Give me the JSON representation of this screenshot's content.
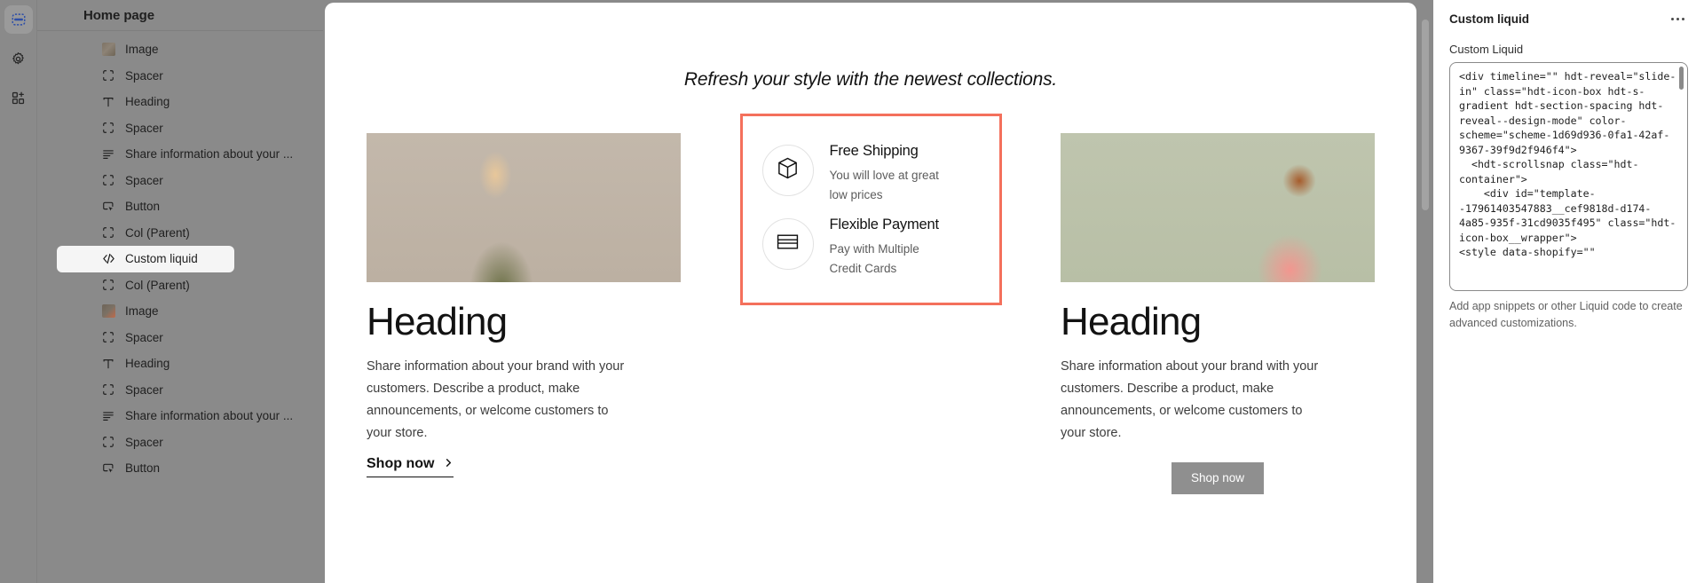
{
  "rail": {
    "items": [
      {
        "name": "sections-icon",
        "label": "Sections",
        "active": true
      },
      {
        "name": "settings-gear-icon",
        "label": "Theme settings",
        "active": false
      },
      {
        "name": "add-apps-icon",
        "label": "Apps",
        "active": false
      }
    ]
  },
  "sidebar": {
    "title": "Home page",
    "items": [
      {
        "label": "Image",
        "icon": "image-thumbnail-icon",
        "selected": false
      },
      {
        "label": "Spacer",
        "icon": "spacer-icon",
        "selected": false
      },
      {
        "label": "Heading",
        "icon": "text-heading-icon",
        "selected": false
      },
      {
        "label": "Spacer",
        "icon": "spacer-icon",
        "selected": false
      },
      {
        "label": "Share information about your ...",
        "icon": "rich-text-icon",
        "selected": false
      },
      {
        "label": "Spacer",
        "icon": "spacer-icon",
        "selected": false
      },
      {
        "label": "Button",
        "icon": "button-cursor-icon",
        "selected": false
      },
      {
        "label": "Col (Parent)",
        "icon": "spacer-icon",
        "selected": false
      },
      {
        "label": "Custom liquid",
        "icon": "code-icon",
        "selected": true
      },
      {
        "label": "Col (Parent)",
        "icon": "spacer-icon",
        "selected": false
      },
      {
        "label": "Image",
        "icon": "image-thumbnail-icon-b",
        "selected": false
      },
      {
        "label": "Spacer",
        "icon": "spacer-icon",
        "selected": false
      },
      {
        "label": "Heading",
        "icon": "text-heading-icon",
        "selected": false
      },
      {
        "label": "Spacer",
        "icon": "spacer-icon",
        "selected": false
      },
      {
        "label": "Share information about your ...",
        "icon": "rich-text-icon",
        "selected": false
      },
      {
        "label": "Spacer",
        "icon": "spacer-icon",
        "selected": false
      },
      {
        "label": "Button",
        "icon": "button-cursor-icon",
        "selected": false
      }
    ]
  },
  "preview": {
    "tagline": "Refresh your style with the newest collections.",
    "left_column": {
      "heading": "Heading",
      "body": "Share information about your brand with your customers. Describe a product, make announcements, or welcome customers to your store.",
      "link_label": "Shop now"
    },
    "right_column": {
      "heading": "Heading",
      "body": "Share information about your brand with your customers. Describe a product, make announcements, or welcome customers to your store.",
      "button_label": "Shop now"
    },
    "icon_box": {
      "highlight_color": "#f4705c",
      "rows": [
        {
          "icon": "box-package-icon",
          "title": "Free Shipping",
          "subtitle": "You will love at great low prices"
        },
        {
          "icon": "credit-card-icon",
          "title": "Flexible Payment",
          "subtitle": "Pay with Multiple Credit Cards"
        }
      ]
    }
  },
  "right_panel": {
    "title": "Custom liquid",
    "menu_icon": "more-options-icon",
    "field_label": "Custom Liquid",
    "code_value": "<div timeline=\"\" hdt-reveal=\"slide-in\" class=\"hdt-icon-box hdt-s-gradient hdt-section-spacing hdt-reveal--design-mode\" color-scheme=\"scheme-1d69d936-0fa1-42af-9367-39f9d2f946f4\">\n  <hdt-scrollsnap class=\"hdt-container\">\n    <div id=\"template--17961403547883__cef9818d-d174-4a85-935f-31cd9035f495\" class=\"hdt-icon-box__wrapper\">\n<style data-shopify=\"\"",
    "help_text": "Add app snippets or other Liquid code to create advanced customizations."
  }
}
